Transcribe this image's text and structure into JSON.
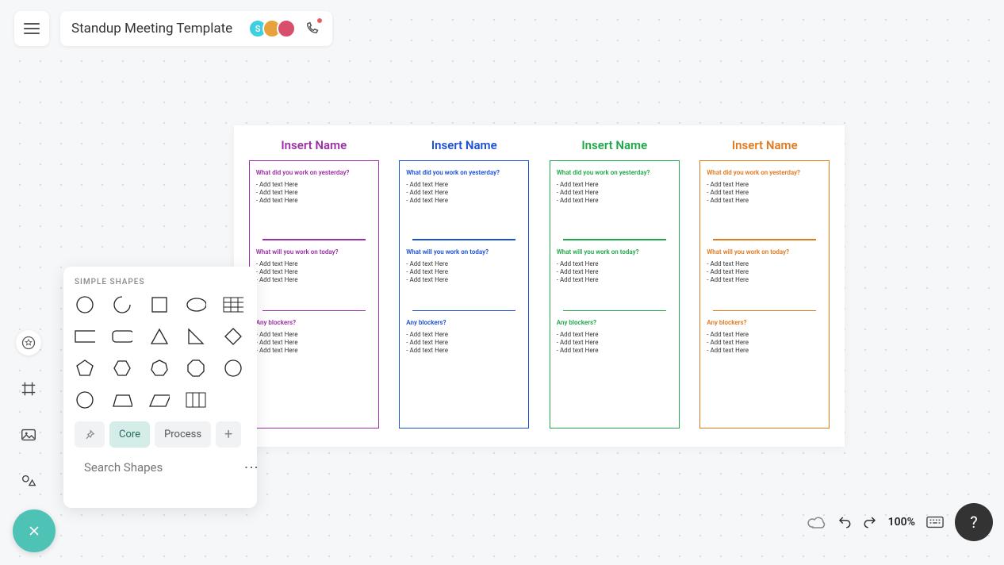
{
  "header": {
    "title": "Standup Meeting Template",
    "avatars": [
      {
        "bg": "#3ecfe0",
        "label": "S"
      },
      {
        "bg": "#e8a23c",
        "label": ""
      },
      {
        "bg": "#d84e6b",
        "label": ""
      }
    ]
  },
  "shapes_panel": {
    "title": "SIMPLE SHAPES",
    "tabs": {
      "pin": "📌",
      "core": "Core",
      "process": "Process",
      "add": "+"
    },
    "search_placeholder": "Search Shapes"
  },
  "columns": [
    {
      "name": "Insert Name",
      "color": "#9b2fa5"
    },
    {
      "name": "Insert Name",
      "color": "#1a4fd6"
    },
    {
      "name": "Insert Name",
      "color": "#1fa84a"
    },
    {
      "name": "Insert Name",
      "color": "#e07a1f"
    }
  ],
  "sections": [
    {
      "q": "What did you work on yesterday?",
      "bullets": [
        "Add   text   Here",
        "Add   text   Here",
        "Add   text   Here"
      ]
    },
    {
      "q": "What will you work on today?",
      "bullets": [
        "Add   text   Here",
        "Add   text   Here",
        "Add   text   Here"
      ]
    },
    {
      "q": "Any  blockers?",
      "bullets": [
        "Add   text   Here",
        "Add   text   Here",
        "Add   text   Here"
      ]
    }
  ],
  "section_q_green_0": "What did you work  on yesterday?",
  "footer": {
    "zoom": "100%"
  }
}
